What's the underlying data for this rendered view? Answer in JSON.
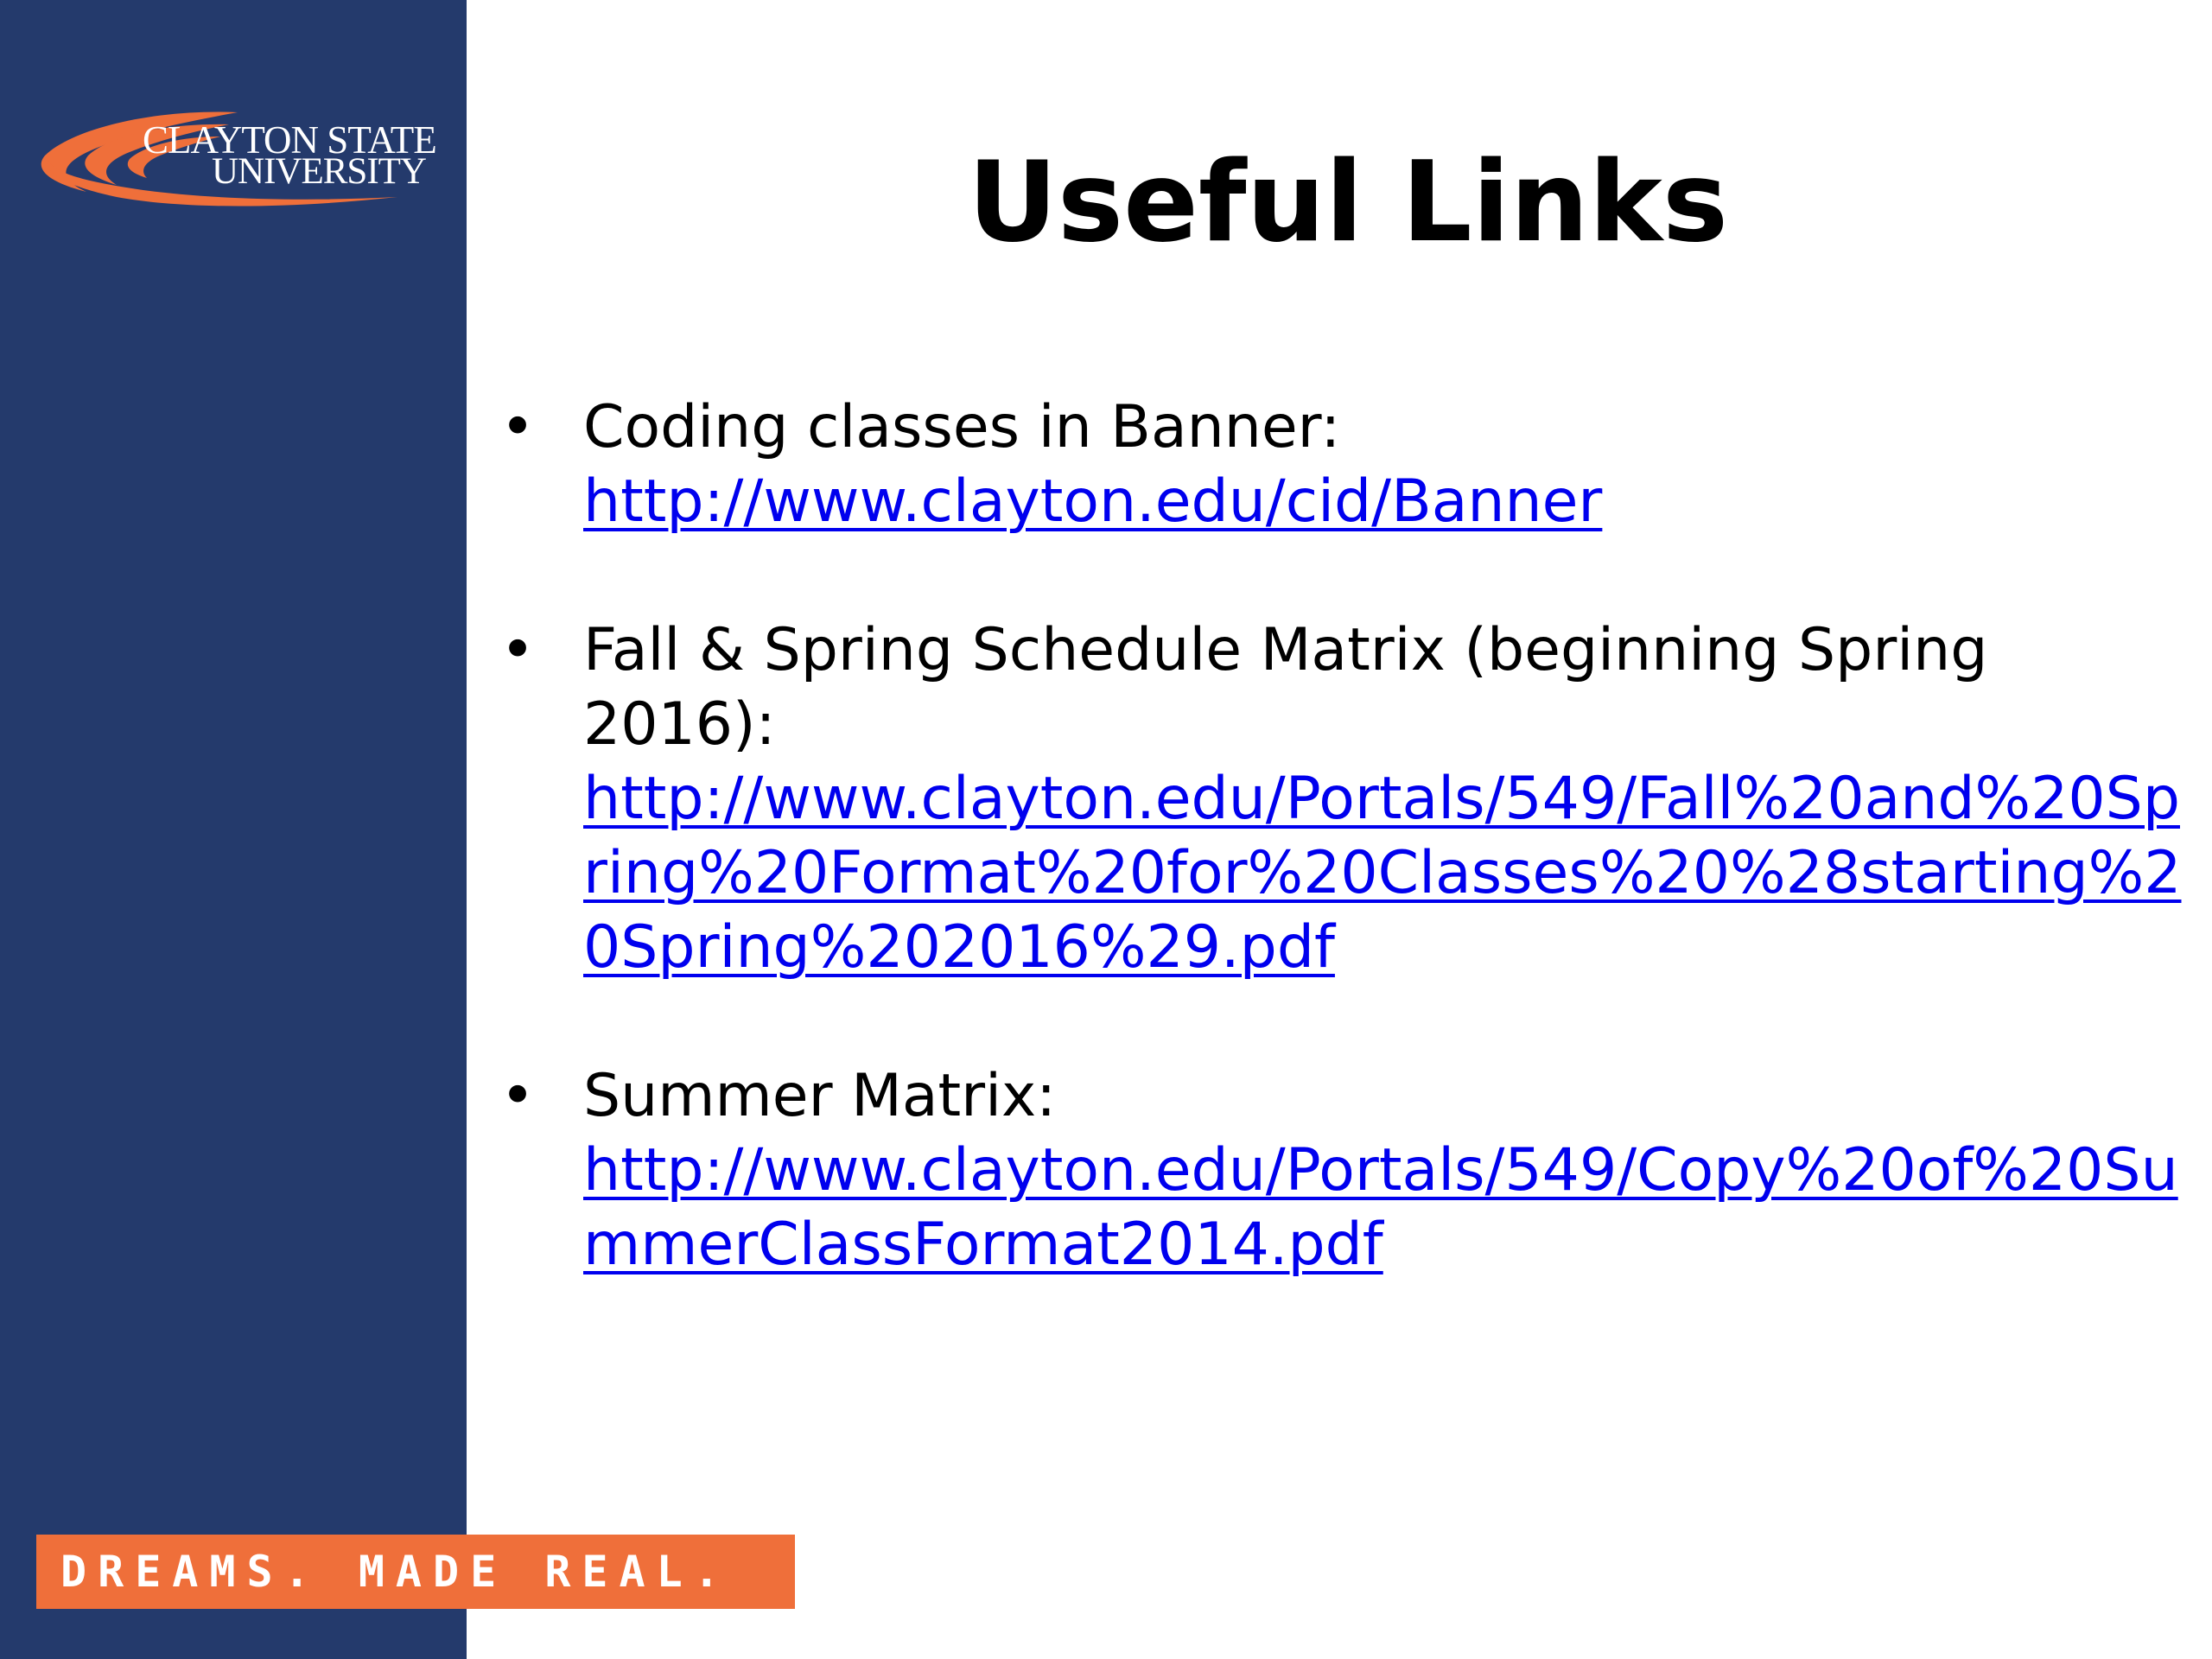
{
  "slide": {
    "title": "Useful Links",
    "colors": {
      "sidebar": "#243a6c",
      "accent_orange": "#ef6f3a",
      "link": "#0000ee",
      "text": "#000000",
      "background": "#ffffff"
    }
  },
  "logo": {
    "line1": "CLAYTON STATE",
    "line2": "UNIVERSITY",
    "icon": "swoosh-icon"
  },
  "tagline": "DREAMS. MADE REAL.",
  "bullets": [
    {
      "label": "Coding classes in Banner:",
      "link": "http://www.clayton.edu/cid/Banner"
    },
    {
      "label": "Fall & Spring Schedule Matrix (beginning Spring 2016):",
      "link": "http://www.clayton.edu/Portals/549/Fall%20and%20Spring%20Format%20for%20Classes%20%28starting%20Spring%202016%29.pdf"
    },
    {
      "label": "Summer Matrix:",
      "link": "http://www.clayton.edu/Portals/549/Copy%20of%20SummerClassFormat2014.pdf"
    }
  ]
}
